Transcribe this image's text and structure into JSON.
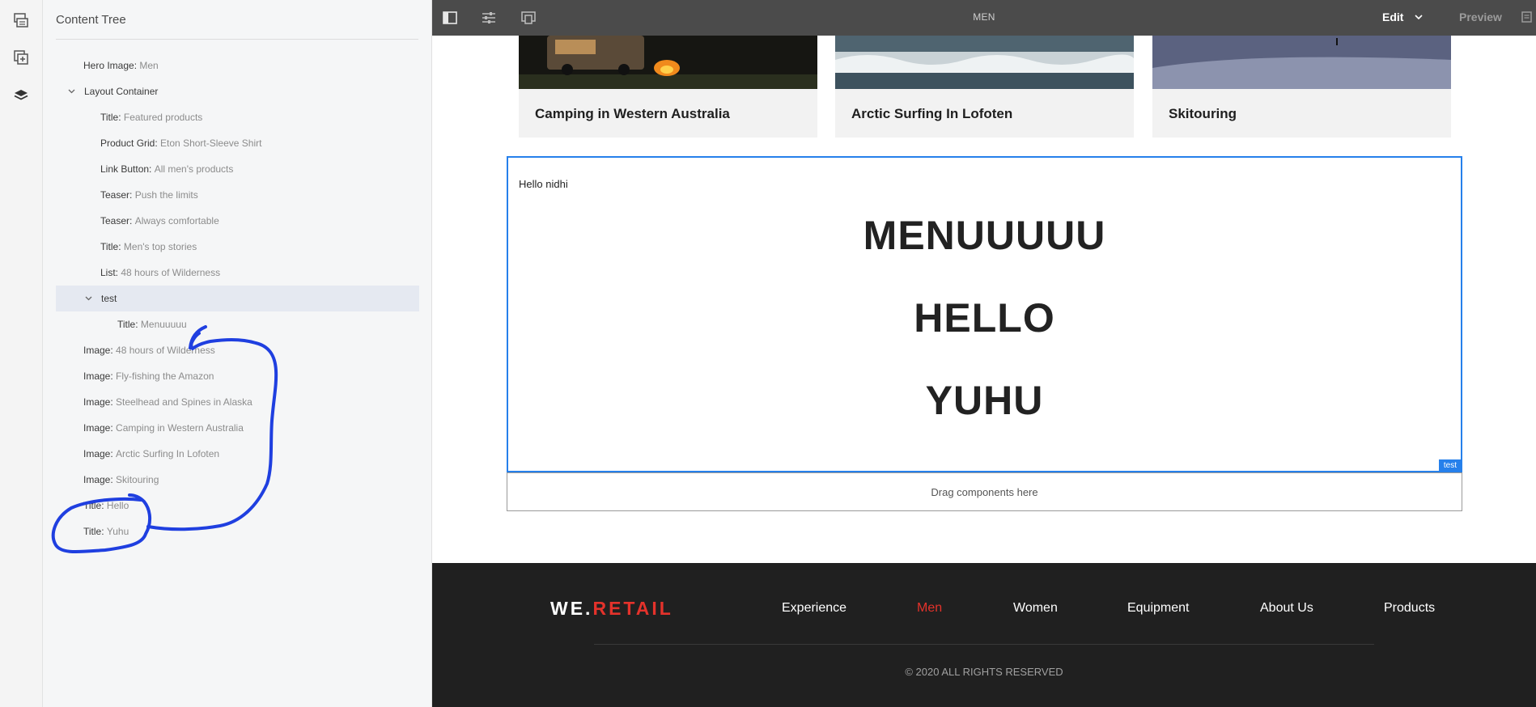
{
  "panel": {
    "title": "Content Tree",
    "tree": [
      {
        "label": "Hero Image:",
        "value": "Men"
      },
      {
        "label": "Layout Container",
        "value": ""
      },
      {
        "label": "Title:",
        "value": "Featured products"
      },
      {
        "label": "Product Grid:",
        "value": "Eton Short-Sleeve Shirt"
      },
      {
        "label": "Link Button:",
        "value": "All men's products"
      },
      {
        "label": "Teaser:",
        "value": "Push the limits"
      },
      {
        "label": "Teaser:",
        "value": "Always comfortable"
      },
      {
        "label": "Title:",
        "value": "Men's top stories"
      },
      {
        "label": "List:",
        "value": "48 hours of Wilderness"
      },
      {
        "label": "test",
        "value": ""
      },
      {
        "label": "Title:",
        "value": "Menuuuuu"
      },
      {
        "label": "Image:",
        "value": "48 hours of Wilderness"
      },
      {
        "label": "Image:",
        "value": "Fly-fishing the Amazon"
      },
      {
        "label": "Image:",
        "value": "Steelhead and Spines in Alaska"
      },
      {
        "label": "Image:",
        "value": "Camping in Western Australia"
      },
      {
        "label": "Image:",
        "value": "Arctic Surfing In Lofoten"
      },
      {
        "label": "Image:",
        "value": "Skitouring"
      },
      {
        "label": "Title:",
        "value": "Hello"
      },
      {
        "label": "Title:",
        "value": "Yuhu"
      }
    ]
  },
  "toolbar": {
    "page_title": "MEN",
    "edit_label": "Edit",
    "preview_label": "Preview"
  },
  "cards": [
    {
      "title": "Camping in Western Australia"
    },
    {
      "title": "Arctic Surfing In Lofoten"
    },
    {
      "title": "Skitouring"
    }
  ],
  "test_component": {
    "small_text": "Hello nidhi",
    "heading1": "MENUUUUU",
    "heading2": "HELLO",
    "heading3": "YUHU",
    "tag": "test"
  },
  "drag_placeholder": "Drag components here",
  "footer": {
    "logo_we": "WE.",
    "logo_retail": "RETAIL",
    "nav": [
      "Experience",
      "Men",
      "Women",
      "Equipment",
      "About Us",
      "Products"
    ],
    "active_nav": "Men",
    "copyright": "© 2020 ALL RIGHTS RESERVED"
  },
  "colors": {
    "accent": "#2680eb",
    "brand_red": "#e4322b",
    "annotation": "#1f3fe0",
    "toolbar_bg": "#4b4b4b",
    "footer_bg": "#202020"
  }
}
